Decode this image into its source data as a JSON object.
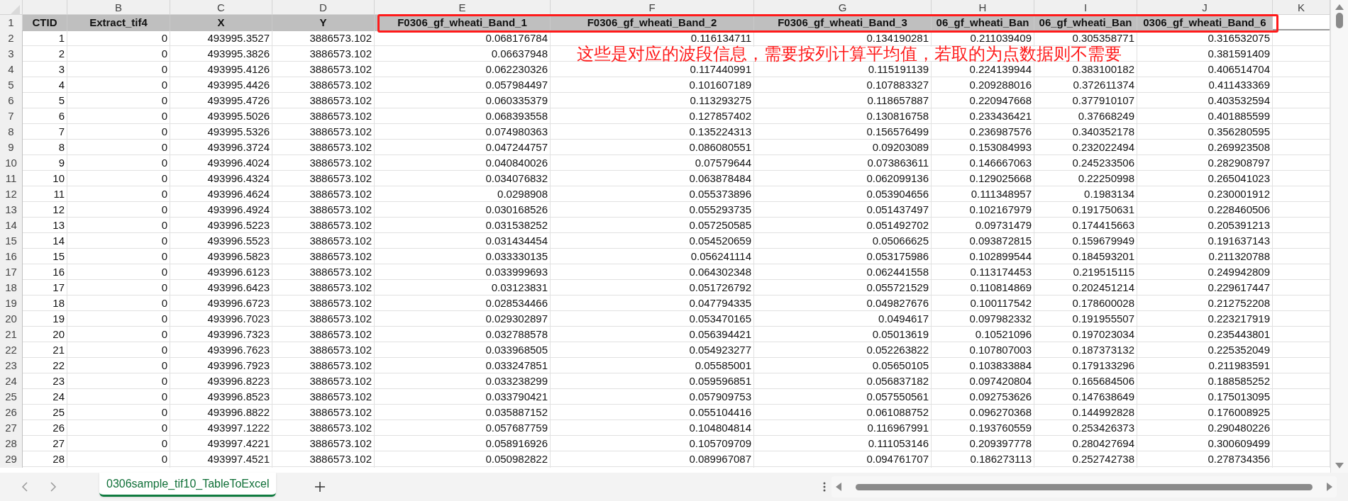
{
  "column_letters": [
    "B",
    "C",
    "D",
    "E",
    "F",
    "G",
    "H",
    "I",
    "J",
    "K"
  ],
  "header_row": {
    "number": "1",
    "cells": [
      "CTID",
      "Extract_tif4",
      "X",
      "Y",
      "F0306_gf_wheati_Band_1",
      "F0306_gf_wheati_Band_2",
      "F0306_gf_wheati_Band_3",
      "06_gf_wheati_Ban",
      "06_gf_wheati_Ban",
      "0306_gf_wheati_Band_6"
    ]
  },
  "rows": [
    {
      "number": "2",
      "cells": [
        "1",
        "0",
        "493995.3527",
        "3886573.102",
        "0.068176784",
        "0.116134711",
        "0.134190281",
        "0.211039409",
        "0.305358771",
        "0.316532075"
      ]
    },
    {
      "number": "3",
      "cells": [
        "2",
        "0",
        "493995.3826",
        "3886573.102",
        "0.06637948",
        "0.381591409"
      ],
      "annotation": "这些是对应的波段信息，需要按列计算平均值，若取的为点数据则不需要"
    },
    {
      "number": "4",
      "cells": [
        "3",
        "0",
        "493995.4126",
        "3886573.102",
        "0.062230326",
        "0.117440991",
        "0.115191139",
        "0.224139944",
        "0.383100182",
        "0.406514704"
      ]
    },
    {
      "number": "5",
      "cells": [
        "4",
        "0",
        "493995.4426",
        "3886573.102",
        "0.057984497",
        "0.101607189",
        "0.107883327",
        "0.209288016",
        "0.372611374",
        "0.411433369"
      ]
    },
    {
      "number": "6",
      "cells": [
        "5",
        "0",
        "493995.4726",
        "3886573.102",
        "0.060335379",
        "0.113293275",
        "0.118657887",
        "0.220947668",
        "0.377910107",
        "0.403532594"
      ]
    },
    {
      "number": "7",
      "cells": [
        "6",
        "0",
        "493995.5026",
        "3886573.102",
        "0.068393558",
        "0.127857402",
        "0.130816758",
        "0.233436421",
        "0.37668249",
        "0.401885599"
      ]
    },
    {
      "number": "8",
      "cells": [
        "7",
        "0",
        "493995.5326",
        "3886573.102",
        "0.074980363",
        "0.135224313",
        "0.156576499",
        "0.236987576",
        "0.340352178",
        "0.356280595"
      ]
    },
    {
      "number": "9",
      "cells": [
        "8",
        "0",
        "493996.3724",
        "3886573.102",
        "0.047244757",
        "0.086080551",
        "0.09203089",
        "0.153084993",
        "0.232022494",
        "0.269923508"
      ]
    },
    {
      "number": "10",
      "cells": [
        "9",
        "0",
        "493996.4024",
        "3886573.102",
        "0.040840026",
        "0.07579644",
        "0.073863611",
        "0.146667063",
        "0.245233506",
        "0.282908797"
      ]
    },
    {
      "number": "11",
      "cells": [
        "10",
        "0",
        "493996.4324",
        "3886573.102",
        "0.034076832",
        "0.063878484",
        "0.062099136",
        "0.129025668",
        "0.22250998",
        "0.265041023"
      ]
    },
    {
      "number": "12",
      "cells": [
        "11",
        "0",
        "493996.4624",
        "3886573.102",
        "0.0298908",
        "0.055373896",
        "0.053904656",
        "0.111348957",
        "0.1983134",
        "0.230001912"
      ]
    },
    {
      "number": "13",
      "cells": [
        "12",
        "0",
        "493996.4924",
        "3886573.102",
        "0.030168526",
        "0.055293735",
        "0.051437497",
        "0.102167979",
        "0.191750631",
        "0.228460506"
      ]
    },
    {
      "number": "14",
      "cells": [
        "13",
        "0",
        "493996.5223",
        "3886573.102",
        "0.031538252",
        "0.057250585",
        "0.051492702",
        "0.09731479",
        "0.174415663",
        "0.205391213"
      ]
    },
    {
      "number": "15",
      "cells": [
        "14",
        "0",
        "493996.5523",
        "3886573.102",
        "0.031434454",
        "0.054520659",
        "0.05066625",
        "0.093872815",
        "0.159679949",
        "0.191637143"
      ]
    },
    {
      "number": "16",
      "cells": [
        "15",
        "0",
        "493996.5823",
        "3886573.102",
        "0.033330135",
        "0.056241114",
        "0.053175986",
        "0.102899544",
        "0.184593201",
        "0.211320788"
      ]
    },
    {
      "number": "17",
      "cells": [
        "16",
        "0",
        "493996.6123",
        "3886573.102",
        "0.033999693",
        "0.064302348",
        "0.062441558",
        "0.113174453",
        "0.219515115",
        "0.249942809"
      ]
    },
    {
      "number": "18",
      "cells": [
        "17",
        "0",
        "493996.6423",
        "3886573.102",
        "0.03123831",
        "0.051726792",
        "0.055721529",
        "0.110814869",
        "0.202451214",
        "0.229617447"
      ]
    },
    {
      "number": "19",
      "cells": [
        "18",
        "0",
        "493996.6723",
        "3886573.102",
        "0.028534466",
        "0.047794335",
        "0.049827676",
        "0.100117542",
        "0.178600028",
        "0.212752208"
      ]
    },
    {
      "number": "20",
      "cells": [
        "19",
        "0",
        "493996.7023",
        "3886573.102",
        "0.029302897",
        "0.053470165",
        "0.0494617",
        "0.097982332",
        "0.191955507",
        "0.223217919"
      ]
    },
    {
      "number": "21",
      "cells": [
        "20",
        "0",
        "493996.7323",
        "3886573.102",
        "0.032788578",
        "0.056394421",
        "0.05013619",
        "0.10521096",
        "0.197023034",
        "0.235443801"
      ]
    },
    {
      "number": "22",
      "cells": [
        "21",
        "0",
        "493996.7623",
        "3886573.102",
        "0.033968505",
        "0.054923277",
        "0.052263822",
        "0.107807003",
        "0.187373132",
        "0.225352049"
      ]
    },
    {
      "number": "23",
      "cells": [
        "22",
        "0",
        "493996.7923",
        "3886573.102",
        "0.033247851",
        "0.05585001",
        "0.05650105",
        "0.103833884",
        "0.179133296",
        "0.211983591"
      ]
    },
    {
      "number": "24",
      "cells": [
        "23",
        "0",
        "493996.8223",
        "3886573.102",
        "0.033238299",
        "0.059596851",
        "0.056837182",
        "0.097420804",
        "0.165684506",
        "0.188585252"
      ]
    },
    {
      "number": "25",
      "cells": [
        "24",
        "0",
        "493996.8523",
        "3886573.102",
        "0.033790421",
        "0.057909753",
        "0.057550561",
        "0.092753626",
        "0.147638649",
        "0.175013095"
      ]
    },
    {
      "number": "26",
      "cells": [
        "25",
        "0",
        "493996.8822",
        "3886573.102",
        "0.035887152",
        "0.055104416",
        "0.061088752",
        "0.096270368",
        "0.144992828",
        "0.176008925"
      ]
    },
    {
      "number": "27",
      "cells": [
        "26",
        "0",
        "493997.1222",
        "3886573.102",
        "0.057687759",
        "0.104804814",
        "0.116967991",
        "0.193760559",
        "0.253426373",
        "0.290480226"
      ]
    },
    {
      "number": "28",
      "cells": [
        "27",
        "0",
        "493997.4221",
        "3886573.102",
        "0.058916926",
        "0.105709709",
        "0.111053146",
        "0.209397778",
        "0.280427694",
        "0.300609499"
      ]
    },
    {
      "number": "29",
      "cells": [
        "28",
        "0",
        "493997.4521",
        "3886573.102",
        "0.050982822",
        "0.089967087",
        "0.094761707",
        "0.186273113",
        "0.252742738",
        "0.278734356"
      ]
    }
  ],
  "sheet_tabs": [
    {
      "label": "0306sample_tif10_TableToExcel",
      "selected": true
    }
  ]
}
